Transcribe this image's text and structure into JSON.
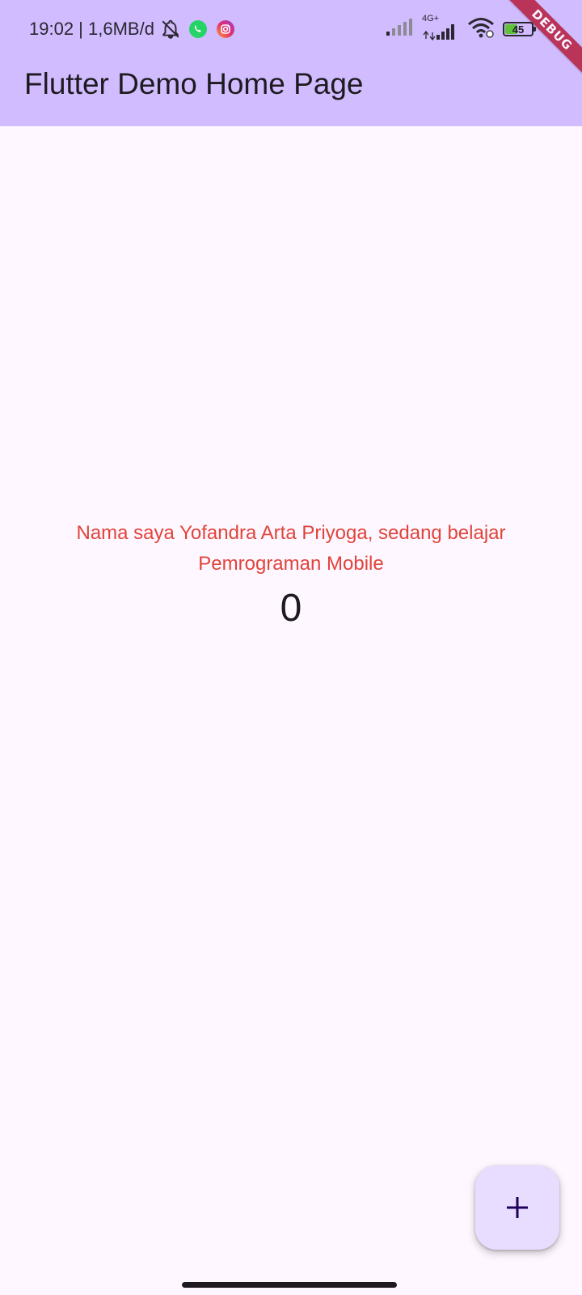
{
  "status_bar": {
    "time_info": "19:02 | 1,6MB/d",
    "battery_level": "45",
    "network_label": "4G+",
    "icons": [
      "bell-off-icon",
      "whatsapp-icon",
      "instagram-icon",
      "signal-icon",
      "mobile-signal-icon",
      "wifi-icon",
      "battery-icon"
    ]
  },
  "app_bar": {
    "title": "Flutter Demo Home Page",
    "background_color": "#d1bcff"
  },
  "debug_banner": {
    "label": "DEBUG",
    "color": "#b71c3d"
  },
  "body": {
    "message": "Nama saya Yofandra Arta Priyoga, sedang belajar Pemrograman Mobile",
    "counter": "0",
    "message_color": "#e0443a",
    "background_color": "#fef7ff"
  },
  "fab": {
    "icon": "plus-icon",
    "background_color": "#e9ddff"
  }
}
